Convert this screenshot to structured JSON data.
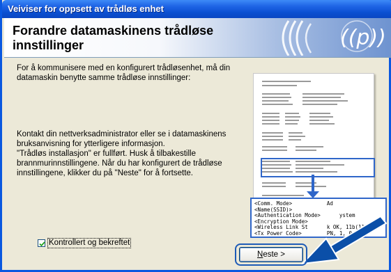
{
  "window": {
    "title": "Veiviser for oppsett av trådløs enhet"
  },
  "banner": {
    "heading": "Forandre datamaskinens trådløse innstillinger"
  },
  "body": {
    "paragraph1": "For å kommunisere med en konfigurert trådløsenhet, må din datamaskin benytte samme trådløse innstillinger:",
    "paragraph2": "Kontakt din nettverksadministrator eller se i datamaskinens bruksanvisning for ytterligere informasjon.\n\"Trådløs installasjon\" er fullført. Husk å tilbakestille brannmurinnstillingene. Når du har konfigurert de trådløse innstillingene, klikker du på \"Neste\" for å fortsette."
  },
  "zoom_lines": [
    "<Comm. Mode>           Ad",
    "<Name(SSID)>",
    "<Authentication Mode>      ystem",
    "<Encryption Mode>",
    "<Wireless Link St      k OK, 11b(11M",
    "<Tx Power Code>        PN, 1, 0"
  ],
  "checkbox": {
    "label": "Kontrollert og bekreftet",
    "checked": true
  },
  "next_button": {
    "label": "Neste >"
  }
}
